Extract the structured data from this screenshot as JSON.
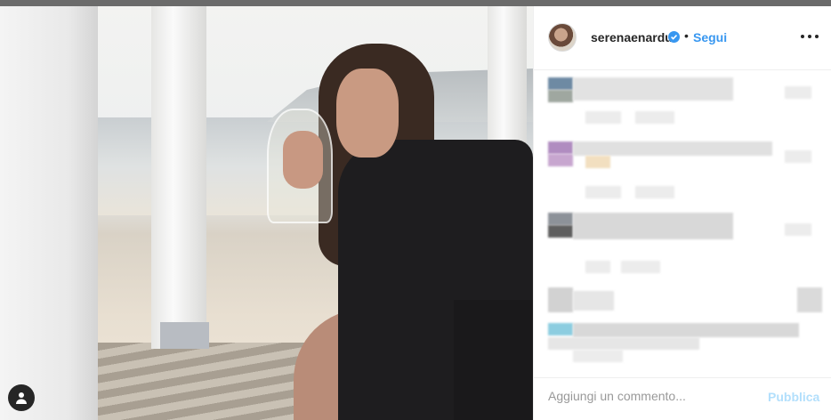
{
  "post": {
    "username": "serenaenardu",
    "separator": "•",
    "follow_label": "Segui",
    "verified_icon": "verified-badge-icon",
    "more_icon": "more-options-icon",
    "user_tag_icon": "user-tag-icon"
  },
  "comment_box": {
    "placeholder": "Aggiungi un commento...",
    "publish_label": "Pubblica"
  },
  "colors": {
    "link_blue": "#3897f0",
    "publish_disabled": "#b2dffc",
    "text": "#262626"
  }
}
